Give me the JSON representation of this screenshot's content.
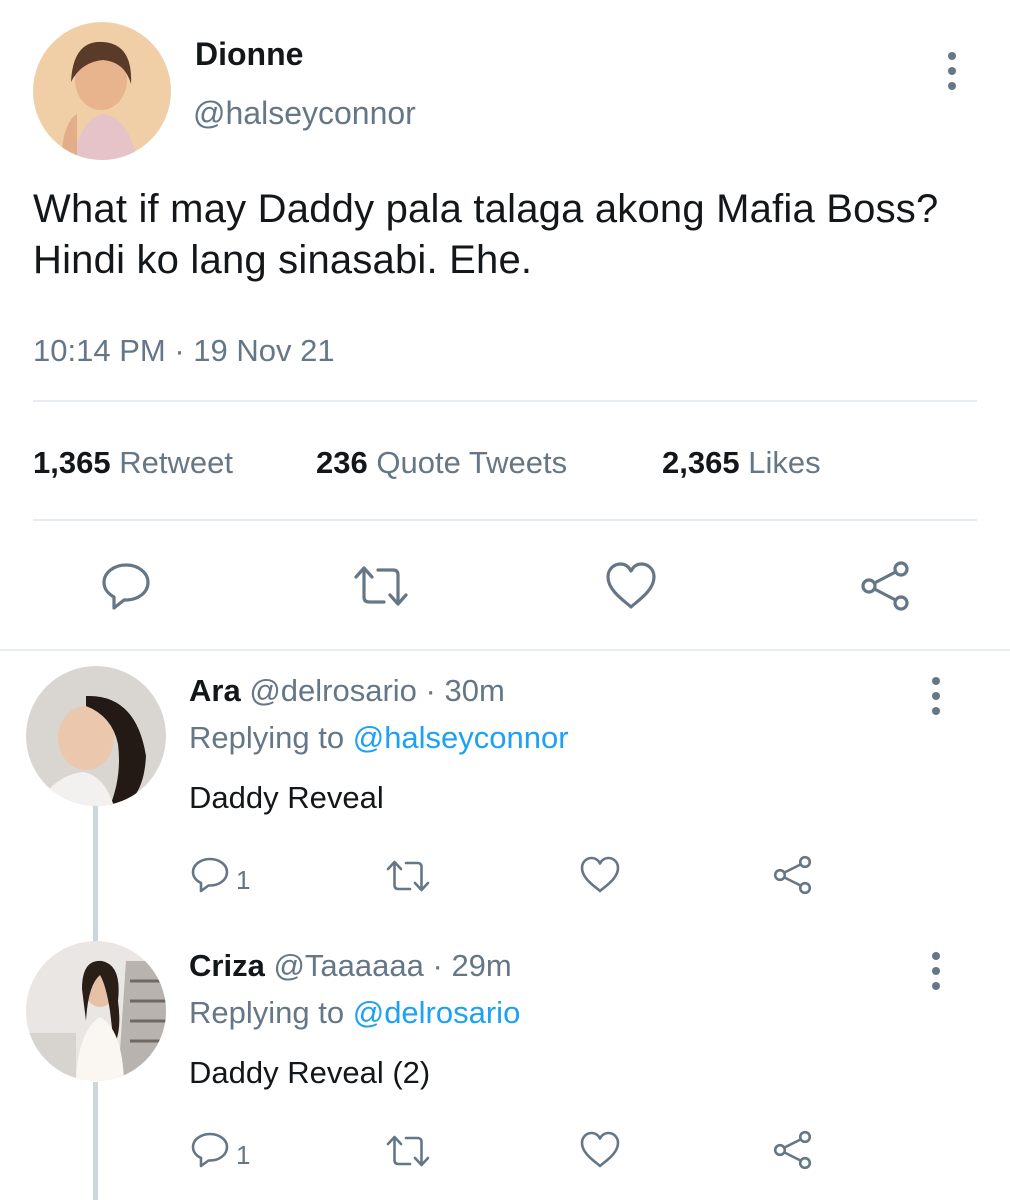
{
  "tweet": {
    "author_name": "Dionne",
    "author_handle": "@halseyconnor",
    "text": "What if may Daddy pala talaga akong Mafia Boss? Hindi ko lang sinasabi. Ehe.",
    "time": "10:14 PM",
    "separator": "·",
    "date": "19 Nov 21",
    "stats": {
      "retweets_count": "1,365",
      "retweets_label": "Retweet",
      "quotes_count": "236",
      "quotes_label": "Quote Tweets",
      "likes_count": "2,365",
      "likes_label": "Likes"
    }
  },
  "replies": [
    {
      "name": "Ara",
      "handle": "@delrosario",
      "time_sep": "·",
      "time": "30m",
      "replying_prefix": "Replying to",
      "replying_handle": "@halseyconnor",
      "text": "Daddy Reveal",
      "reply_count": "1"
    },
    {
      "name": "Criza",
      "handle": "@Taaaaaa",
      "time_sep": "·",
      "time": "29m",
      "replying_prefix": "Replying to",
      "replying_handle": "@delrosario",
      "text": "Daddy Reveal (2)",
      "reply_count": "1"
    }
  ],
  "colors": {
    "text": "#14171a",
    "secondary": "#657786",
    "accent": "#1da1f2",
    "divider": "#e6ecf0"
  },
  "icons": [
    "reply-icon",
    "retweet-icon",
    "like-icon",
    "share-icon",
    "more-icon"
  ]
}
